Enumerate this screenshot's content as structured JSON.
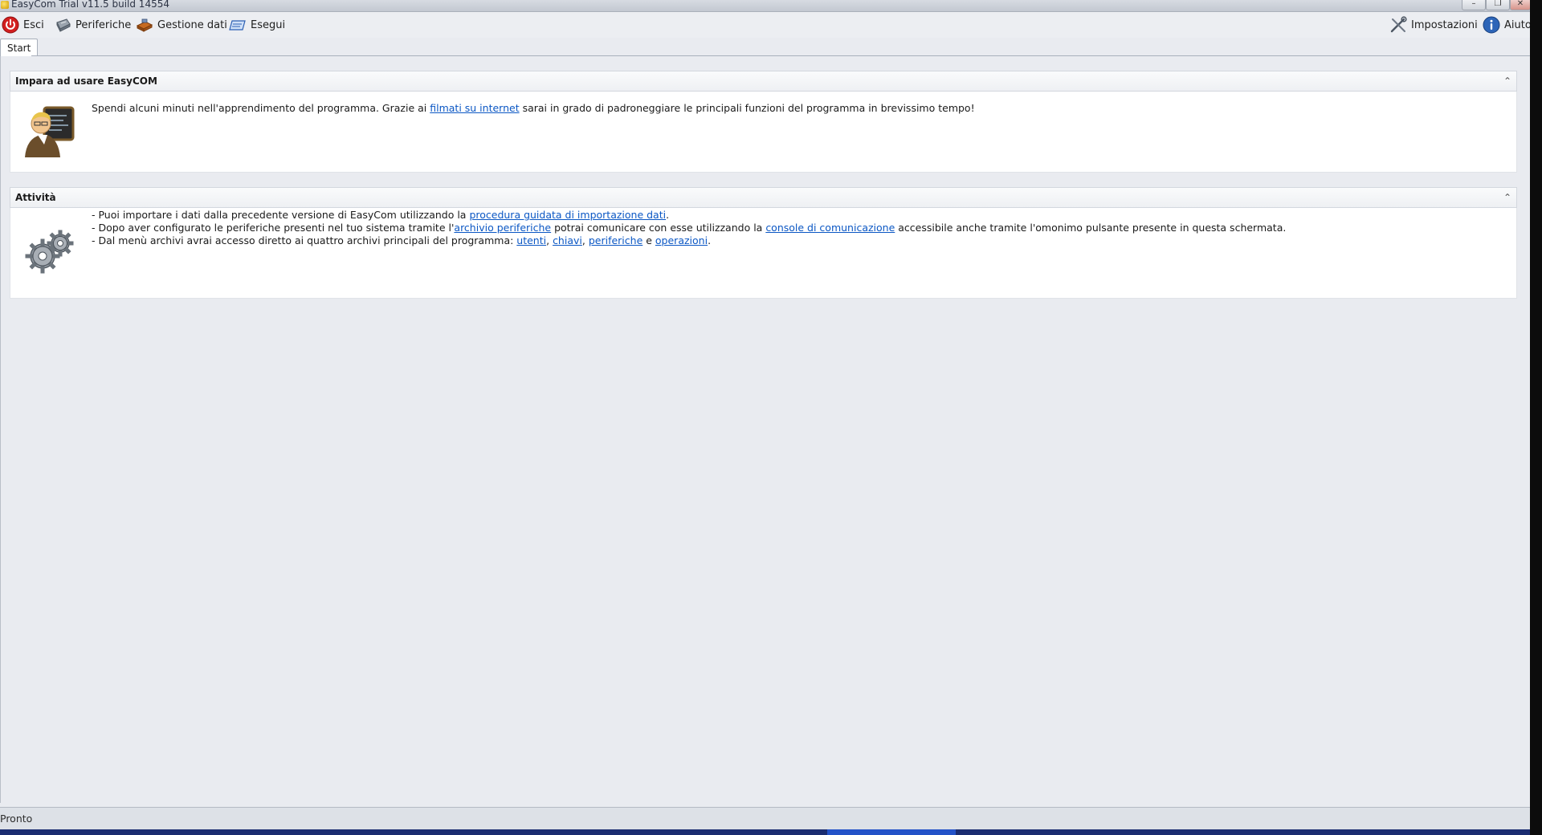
{
  "window": {
    "title": "EasyCom Trial v11.5 build 14554",
    "controls": {
      "minimize": "–",
      "restore": "❐",
      "close": "✕"
    }
  },
  "toolbar": {
    "exit_label": "Esci",
    "devices_label": "Periferiche",
    "data_label": "Gestione dati",
    "run_label": "Esegui",
    "settings_label": "Impostazioni",
    "help_label": "Aiuto"
  },
  "tabs": [
    {
      "label": "Start",
      "selected": true
    }
  ],
  "learn_panel": {
    "title": "Impara ad usare EasyCOM",
    "collapse_glyph": "⌃",
    "text_before": "Spendi alcuni minuti nell'apprendimento del programma. Grazie ai ",
    "link": "filmati su internet",
    "text_after": " sarai in grado di padroneggiare le principali funzioni del programma in brevissimo tempo!"
  },
  "activities_panel": {
    "title": "Attività",
    "collapse_glyph": "⌃",
    "line1": {
      "before": "- Puoi importare i dati dalla precedente versione di EasyCom utilizzando la ",
      "link": "procedura guidata di importazione dati",
      "after": "."
    },
    "line2": {
      "before": "- Dopo aver configurato le periferiche presenti nel tuo sistema tramite l'",
      "link1": "archivio periferiche",
      "middle": " potrai comunicare con esse utilizzando la ",
      "link2": "console di comunicazione",
      "after": " accessibile anche  tramite l'omonimo pulsante presente in questa schermata."
    },
    "line3": {
      "before": "- Dal menù archivi avrai accesso diretto ai quattro archivi principali del programma: ",
      "link_users": "utenti",
      "sep1": ", ",
      "link_keys": "chiavi",
      "sep2": ", ",
      "link_devices": "periferiche",
      "sep3": " e ",
      "link_operations": "operazioni",
      "after": "."
    }
  },
  "status": {
    "text": "Pronto"
  },
  "colors": {
    "link": "#0b57c4",
    "taskbar": "#1a2c70",
    "exit_icon": "#d21f1f"
  }
}
